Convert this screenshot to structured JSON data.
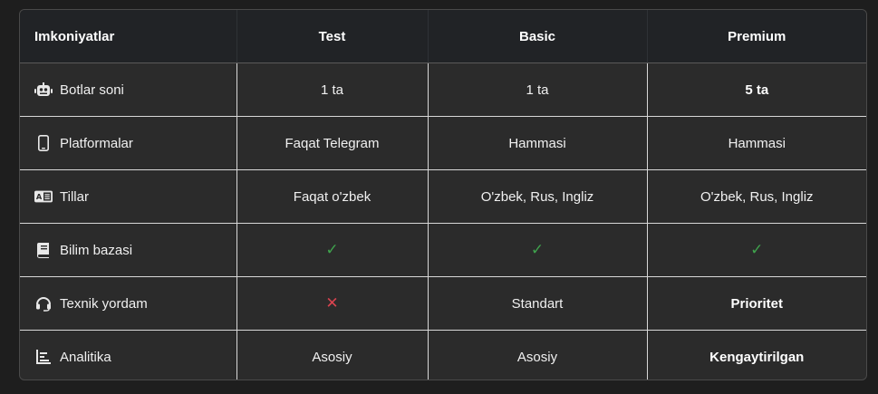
{
  "header": {
    "feature": "Imkoniyatlar",
    "test": "Test",
    "basic": "Basic",
    "premium": "Premium"
  },
  "rows": [
    {
      "icon": "robot-icon",
      "label": "Botlar soni",
      "test": "1 ta",
      "basic": "1 ta",
      "premium": "5 ta"
    },
    {
      "icon": "mobile-phone-icon",
      "label": "Platformalar",
      "test": "Faqat Telegram",
      "basic": "Hammasi",
      "premium": "Hammasi"
    },
    {
      "icon": "language-icon",
      "label": "Tillar",
      "test": "Faqat o'zbek",
      "basic": "O'zbek, Rus, Ingliz",
      "premium": "O'zbek, Rus, Ingliz"
    },
    {
      "icon": "book-icon",
      "label": "Bilim bazasi",
      "test": "✓",
      "basic": "✓",
      "premium": "✓"
    },
    {
      "icon": "headset-icon",
      "label": "Texnik yordam",
      "test": "✕",
      "basic": "Standart",
      "premium": "Prioritet"
    },
    {
      "icon": "chart-icon",
      "label": "Analitika",
      "test": "Asosiy",
      "basic": "Asosiy",
      "premium": "Kengaytirilgan"
    }
  ],
  "colors": {
    "check": "#3fa34d",
    "cross": "#d9434f"
  }
}
